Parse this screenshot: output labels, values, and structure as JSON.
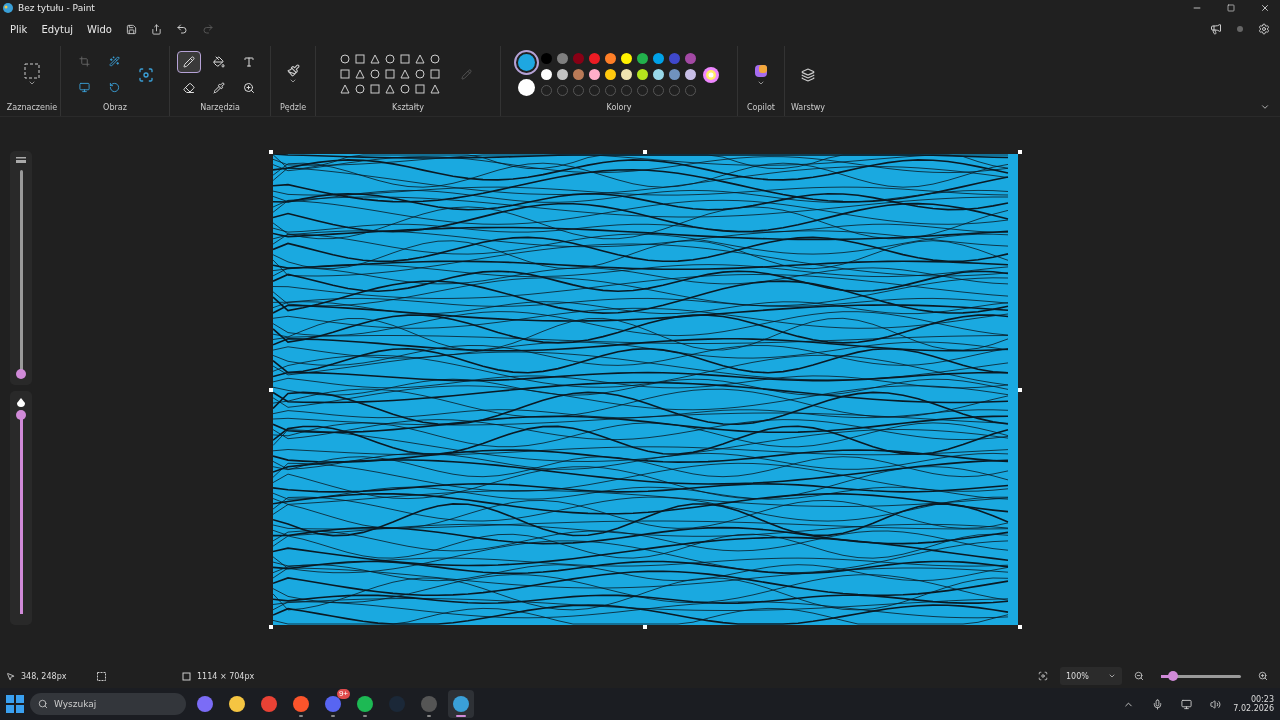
{
  "window": {
    "title": "Bez tytułu - Paint"
  },
  "menu": [
    {
      "label": "Plik"
    },
    {
      "label": "Edytuj"
    },
    {
      "label": "Wido"
    }
  ],
  "ribbon": {
    "groups": [
      "Zaznaczenie",
      "Obraz",
      "Narzędzia",
      "Pędzle",
      "Kształty",
      "Kolory",
      "Copilot",
      "Warstwy"
    ],
    "tools": [
      {
        "selected": true
      },
      {
        "selected": false
      },
      {
        "selected": false
      },
      {
        "selected": false
      },
      {
        "selected": false
      },
      {
        "selected": false
      }
    ]
  },
  "colors": {
    "primary": {
      "color": "#1ea7e1",
      "selected": true
    },
    "secondary": {
      "color": "#ffffff",
      "selected": false
    },
    "palette": [
      {
        "color": "#000000"
      },
      {
        "color": "#7f7f7f"
      },
      {
        "color": "#880015"
      },
      {
        "color": "#ed1c24"
      },
      {
        "color": "#ff7f27"
      },
      {
        "color": "#fff200"
      },
      {
        "color": "#22b14c"
      },
      {
        "color": "#00a2e8"
      },
      {
        "color": "#3f48cc"
      },
      {
        "color": "#a349a4"
      },
      {
        "color": "#ffffff"
      },
      {
        "color": "#c3c3c3"
      },
      {
        "color": "#b97a57"
      },
      {
        "color": "#ffaec9"
      },
      {
        "color": "#ffc90e"
      },
      {
        "color": "#efe4b0"
      },
      {
        "color": "#b5e61d"
      },
      {
        "color": "#99d9ea"
      },
      {
        "color": "#7092be"
      },
      {
        "color": "#c8bfe7"
      }
    ]
  },
  "side_sliders": [
    {
      "level": 0
    },
    {
      "level": 1
    }
  ],
  "status_bar": {
    "cursor": "348, 248px",
    "canvas_size": "1114 × 704px",
    "zoom": "100%",
    "zoom_slider": {
      "level": 0.15
    }
  },
  "taskbar": {
    "search": {
      "placeholder": "Wyszukaj"
    },
    "apps": [
      {
        "running": false,
        "selected": false
      },
      {
        "running": false,
        "selected": false
      },
      {
        "running": false,
        "selected": false
      },
      {
        "running": true,
        "selected": false
      },
      {
        "running": true,
        "selected": false,
        "badge": "9+"
      },
      {
        "running": true,
        "selected": false
      },
      {
        "running": false,
        "selected": false
      },
      {
        "running": true,
        "selected": false
      },
      {
        "running": true,
        "selected": true
      }
    ],
    "time": "00:23",
    "date": "7.02.2026"
  }
}
